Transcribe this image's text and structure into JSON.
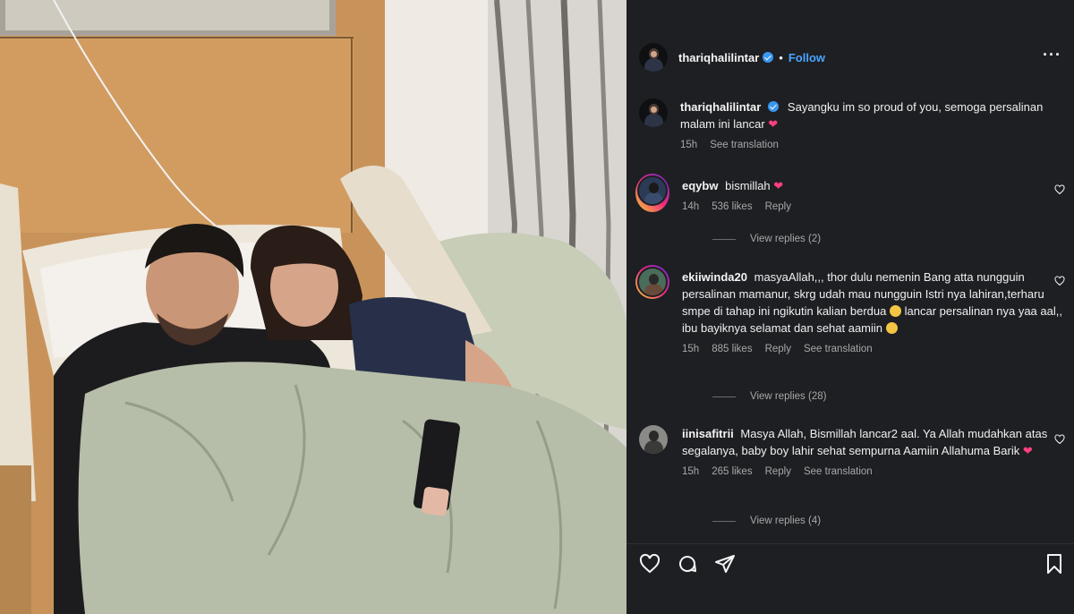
{
  "post": {
    "username": "thariqhalilintar",
    "separator": "•",
    "follow_label": "Follow",
    "more_label": "···"
  },
  "caption": {
    "username": "thariqhalilintar",
    "text": "Sayangku im so proud of you, semoga persalinan malam ini lancar",
    "emoji": "❤",
    "time": "15h",
    "see_translation": "See translation"
  },
  "comments": [
    {
      "username": "eqybw",
      "text": "bismillah",
      "emoji": "❤",
      "time": "14h",
      "likes": "536 likes",
      "reply": "Reply",
      "view_replies": "View replies (2)"
    },
    {
      "username": "ekiiwinda20",
      "text": "masyaAllah,,, thor dulu nemenin Bang atta nungguin persalinan mamanur, skrg udah mau nungguin Istri nya lahiran,terharu smpe di tahap ini ngikutin kalian berdua",
      "text2": "lancar persalinan nya yaa aal,, ibu bayiknya selamat dan sehat aamiin",
      "time": "15h",
      "likes": "885 likes",
      "reply": "Reply",
      "see_translation": "See translation",
      "view_replies": "View replies (28)"
    },
    {
      "username": "iinisafitrii",
      "text": "Masya Allah, Bismillah lancar2 aal. Ya Allah mudahkan atas segalanya, baby boy lahir sehat sempurna Aamiin Allahuma Barik",
      "emoji": "❤",
      "time": "15h",
      "likes": "265 likes",
      "reply": "Reply",
      "see_translation": "See translation",
      "view_replies": "View replies (4)"
    }
  ],
  "icons": {
    "like": "heart-icon",
    "comment": "comment-icon",
    "share": "share-icon",
    "save": "bookmark-icon",
    "verified": "verified-badge-icon"
  },
  "colors": {
    "panel_bg": "#1e1f23",
    "link_blue": "#4aa3ff",
    "verified_blue": "#3897f0",
    "heart_pink": "#ff3f7f"
  }
}
